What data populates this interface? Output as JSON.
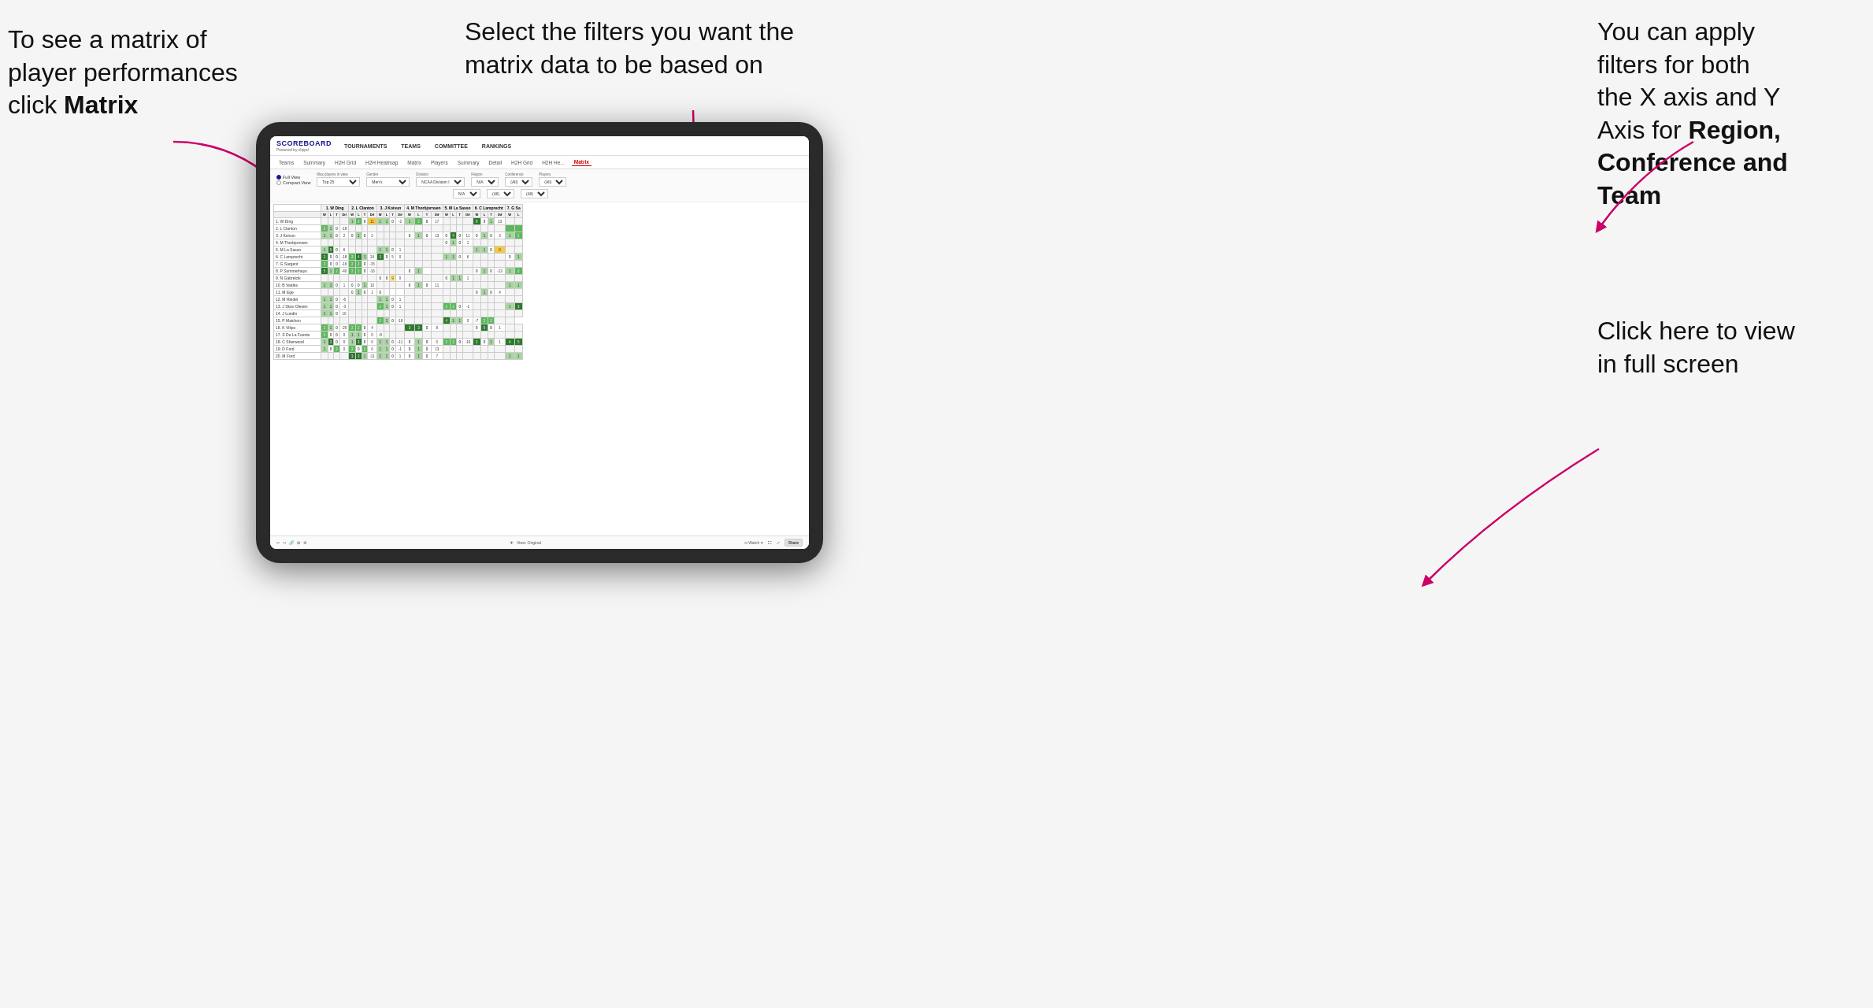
{
  "annotations": {
    "topleft": {
      "line1": "To see a matrix of",
      "line2": "player performances",
      "line3_normal": "click ",
      "line3_bold": "Matrix"
    },
    "topmid": {
      "text": "Select the filters you want the matrix data to be based on"
    },
    "topright": {
      "line1": "You  can apply",
      "line2": "filters for both",
      "line3": "the X axis and Y",
      "line4_normal": "Axis for ",
      "line4_bold": "Region,",
      "line5_bold": "Conference and",
      "line6_bold": "Team"
    },
    "bottomright": {
      "line1": "Click here to view",
      "line2": "in full screen"
    }
  },
  "app": {
    "logo_title": "SCOREBOARD",
    "logo_subtitle": "Powered by clippd",
    "nav_items": [
      "TOURNAMENTS",
      "TEAMS",
      "COMMITTEE",
      "RANKINGS"
    ],
    "sub_nav_items": [
      "Teams",
      "Summary",
      "H2H Grid",
      "H2H Heatmap",
      "Matrix",
      "Players",
      "Summary",
      "Detail",
      "H2H Grid",
      "H2H He...",
      "Matrix"
    ],
    "active_tab": "Matrix",
    "view_options": {
      "full_view_label": "Full View",
      "compact_view_label": "Compact View",
      "selected": "full"
    },
    "filters": {
      "max_players_label": "Max players in view",
      "max_players_value": "Top 25",
      "gender_label": "Gender",
      "gender_value": "Men's",
      "division_label": "Division",
      "division_value": "NCAA Division I",
      "region_label": "Region",
      "region_value": "N/A",
      "conference_label": "Conference",
      "conference_value": "(All)",
      "players_label": "Players",
      "players_value": "(All)",
      "na_row": [
        "N/A",
        "(All)",
        "(All)"
      ]
    },
    "column_headers": [
      "1. W Ding",
      "2. L Clanton",
      "3. J Koivun",
      "4. M Thorbjornsen",
      "5. M La Sasso",
      "6. C Lamprecht",
      "7. G Sa"
    ],
    "sub_headers": [
      "W",
      "L",
      "T",
      "Dif"
    ],
    "rows": [
      {
        "name": "1. W Ding",
        "data": []
      },
      {
        "name": "2. L Clanton",
        "data": []
      },
      {
        "name": "3. J Koivun",
        "data": []
      },
      {
        "name": "4. M Thorbjornsen",
        "data": []
      },
      {
        "name": "5. M La Sasso",
        "data": []
      },
      {
        "name": "6. C Lamprecht",
        "data": []
      },
      {
        "name": "7. G Sargent",
        "data": []
      },
      {
        "name": "8. P Summerhays",
        "data": []
      },
      {
        "name": "9. N Gabrelcik",
        "data": []
      },
      {
        "name": "10. B Valdes",
        "data": []
      },
      {
        "name": "11. M Ege",
        "data": []
      },
      {
        "name": "12. M Riedel",
        "data": []
      },
      {
        "name": "13. J Skov Olesen",
        "data": []
      },
      {
        "name": "14. J Lundin",
        "data": []
      },
      {
        "name": "15. P Maichon",
        "data": []
      },
      {
        "name": "16. K Vilips",
        "data": []
      },
      {
        "name": "17. S De La Fuente",
        "data": []
      },
      {
        "name": "18. C Sherwood",
        "data": []
      },
      {
        "name": "19. D Ford",
        "data": []
      },
      {
        "name": "20. M Ford",
        "data": []
      }
    ],
    "toolbar": {
      "view_label": "View: Original",
      "watch_label": "Watch",
      "share_label": "Share"
    }
  }
}
